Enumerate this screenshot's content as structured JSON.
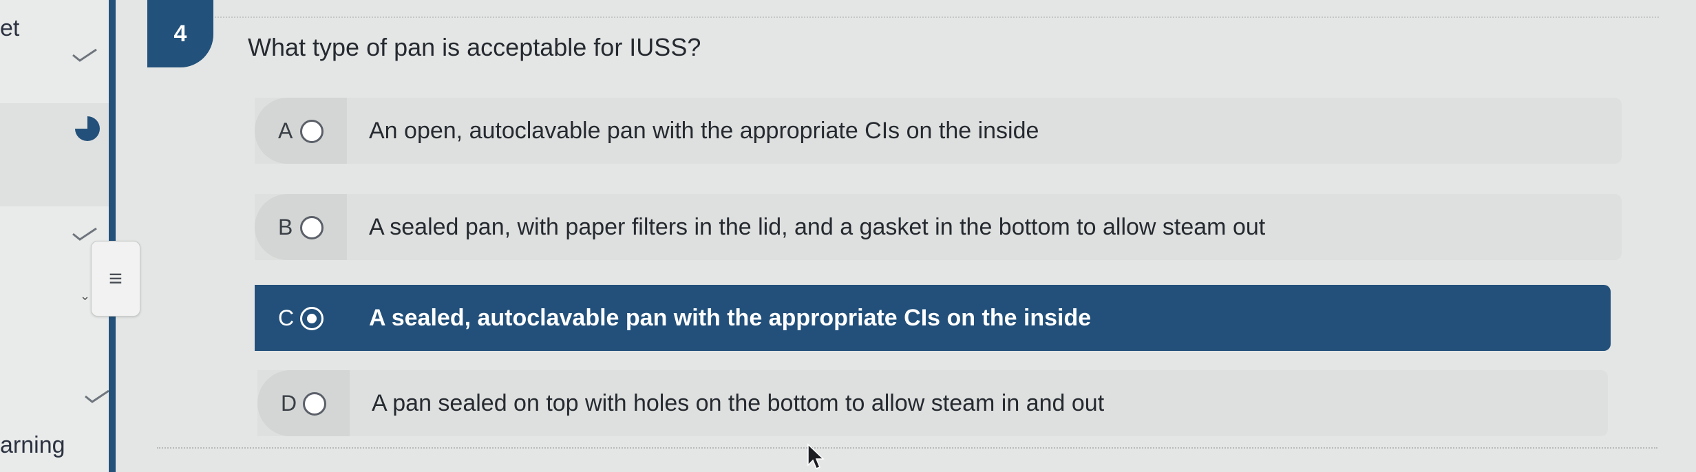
{
  "sidebar": {
    "top_text": "et",
    "bottom_text": "arning",
    "menu_icon": "hamburger-menu-icon"
  },
  "question": {
    "number": "4",
    "text": "What type of pan is acceptable for IUSS?"
  },
  "options": [
    {
      "letter": "A",
      "text": "An open, autoclavable pan with the appropriate CIs on the inside",
      "selected": false
    },
    {
      "letter": "B",
      "text": "A sealed pan, with paper filters in the lid, and a gasket in the bottom to allow steam out",
      "selected": false
    },
    {
      "letter": "C",
      "text": "A sealed, autoclavable pan with the appropriate CIs on the inside",
      "selected": true
    },
    {
      "letter": "D",
      "text": "A pan sealed on top with holes on the bottom to allow steam in and out",
      "selected": false
    }
  ],
  "colors": {
    "accent": "#22507a",
    "background": "#e4e6e5"
  }
}
